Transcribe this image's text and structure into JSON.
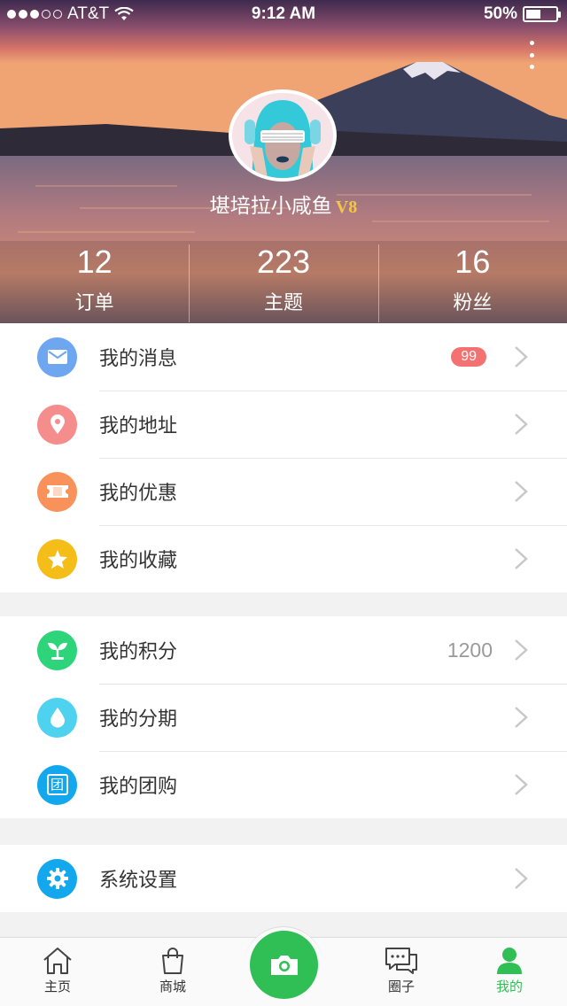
{
  "status_bar": {
    "carrier": "AT&T",
    "time": "9:12 AM",
    "battery": "50%",
    "battery_level": 0.5
  },
  "profile": {
    "username": "堪培拉小咸鱼",
    "vip_level": "V8"
  },
  "stats": [
    {
      "count": "12",
      "label": "订单"
    },
    {
      "count": "223",
      "label": "主题"
    },
    {
      "count": "16",
      "label": "粉丝"
    }
  ],
  "menu_group_1": [
    {
      "label": "我的消息",
      "icon": "mail-icon",
      "color": "#6ea6f0",
      "badge": "99"
    },
    {
      "label": "我的地址",
      "icon": "location-pin-icon",
      "color": "#f58d8d"
    },
    {
      "label": "我的优惠",
      "icon": "coupon-icon",
      "color": "#f8915a"
    },
    {
      "label": "我的收藏",
      "icon": "star-icon",
      "color": "#f4bd17"
    }
  ],
  "menu_group_2": [
    {
      "label": "我的积分",
      "icon": "sprout-icon",
      "color": "#2ed47a",
      "value": "1200"
    },
    {
      "label": "我的分期",
      "icon": "water-drop-icon",
      "color": "#4fd1f0"
    },
    {
      "label": "我的团购",
      "icon": "group-buy-icon",
      "color": "#13a8ee",
      "icon_text": "团"
    }
  ],
  "menu_group_3": [
    {
      "label": "系统设置",
      "icon": "gear-icon",
      "color": "#13a8ee"
    }
  ],
  "tabbar": {
    "home": "主页",
    "mall": "商城",
    "circle": "圈子",
    "me": "我的",
    "active_color": "#2fbf55"
  }
}
